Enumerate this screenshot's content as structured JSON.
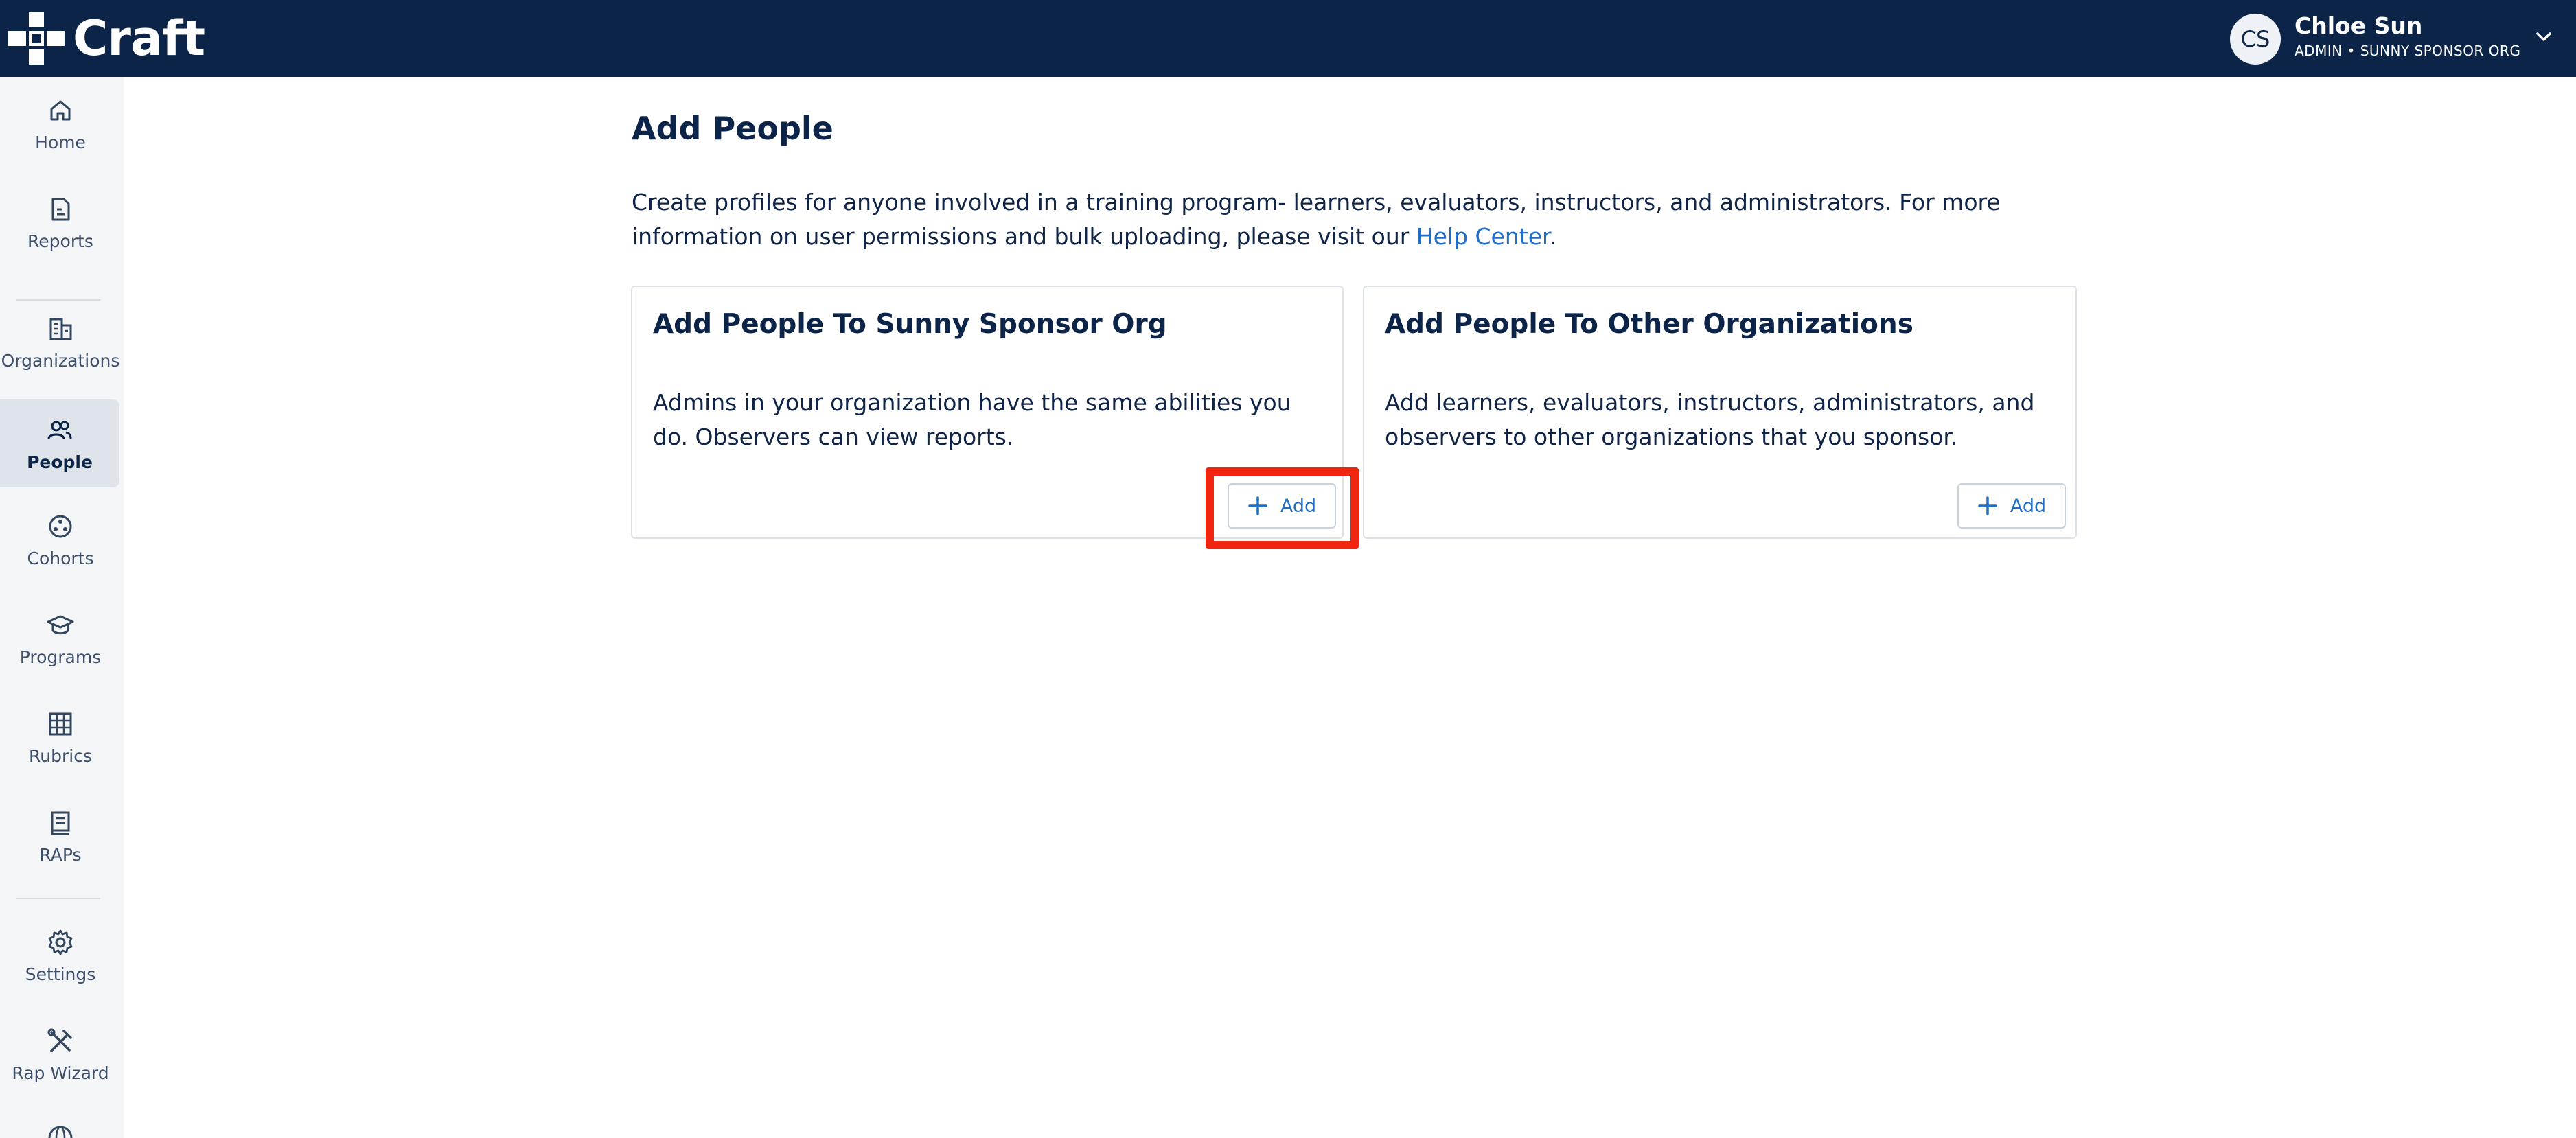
{
  "app": {
    "logo_text": "Craft"
  },
  "user": {
    "initials": "CS",
    "name": "Chloe Sun",
    "role": "ADMIN • SUNNY SPONSOR ORG"
  },
  "sidebar": {
    "items": [
      {
        "label": "Home",
        "icon": "home-icon"
      },
      {
        "label": "Reports",
        "icon": "reports-icon"
      },
      {
        "label": "Organizations",
        "icon": "organizations-icon"
      },
      {
        "label": "People",
        "icon": "people-icon",
        "active": true
      },
      {
        "label": "Cohorts",
        "icon": "cohorts-icon"
      },
      {
        "label": "Programs",
        "icon": "programs-icon"
      },
      {
        "label": "Rubrics",
        "icon": "rubrics-icon"
      },
      {
        "label": "RAPs",
        "icon": "raps-icon"
      },
      {
        "label": "Settings",
        "icon": "gear-icon"
      },
      {
        "label": "Rap Wizard",
        "icon": "tools-icon"
      }
    ]
  },
  "page": {
    "title": "Add People",
    "intro_text": "Create profiles for anyone involved in a training program- learners, evaluators, instructors, and administrators. For more information on user permissions and bulk uploading, please visit our ",
    "intro_link": "Help Center",
    "intro_end": "."
  },
  "cards": [
    {
      "title": "Add People To Sunny Sponsor Org",
      "description": "Admins in your organization have the same abilities you do. Observers can view reports.",
      "button_label": "Add"
    },
    {
      "title": "Add People To Other Organizations",
      "description": "Add learners, evaluators, instructors, administrators, and observers to other organizations that you sponsor.",
      "button_label": "Add"
    }
  ],
  "colors": {
    "topbar": "#0b2447",
    "accent": "#1f6fc9",
    "highlight": "#f0240f",
    "sidebar": "#f3f5f7"
  }
}
